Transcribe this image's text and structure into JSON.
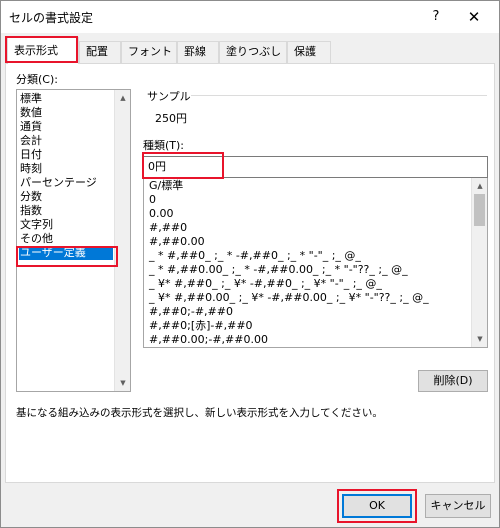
{
  "window": {
    "title": "セルの書式設定",
    "help": "?",
    "close": "✕"
  },
  "tabs": [
    {
      "label": "表示形式",
      "active": true
    },
    {
      "label": "配置"
    },
    {
      "label": "フォント"
    },
    {
      "label": "罫線"
    },
    {
      "label": "塗りつぶし"
    },
    {
      "label": "保護"
    }
  ],
  "category": {
    "label": "分類(C):",
    "items": [
      "標準",
      "数値",
      "通貨",
      "会計",
      "日付",
      "時刻",
      "パーセンテージ",
      "分数",
      "指数",
      "文字列",
      "その他",
      "ユーザー定義"
    ],
    "selected_index": 11
  },
  "sample": {
    "label": "サンプル",
    "value": "250円"
  },
  "type": {
    "label": "種類(T):",
    "value": "0円",
    "formats": [
      "G/標準",
      "0",
      "0.00",
      "#,##0",
      "#,##0.00",
      "_ * #,##0_ ;_ * -#,##0_ ;_ * \"-\"_ ;_ @_",
      "_ * #,##0.00_ ;_ * -#,##0.00_ ;_ * \"-\"??_ ;_ @_",
      "_ ¥* #,##0_ ;_ ¥* -#,##0_ ;_ ¥* \"-\"_ ;_ @_",
      "_ ¥* #,##0.00_ ;_ ¥* -#,##0.00_ ;_ ¥* \"-\"??_ ;_ @_",
      "#,##0;-#,##0",
      "#,##0;[赤]-#,##0",
      "#,##0.00;-#,##0.00"
    ]
  },
  "delete_button": "削除(D)",
  "description": "基になる組み込みの表示形式を選択し、新しい表示形式を入力してください。",
  "footer": {
    "ok": "OK",
    "cancel": "キャンセル"
  },
  "colors": {
    "highlight": "#e8142b",
    "selection": "#0078d7"
  }
}
